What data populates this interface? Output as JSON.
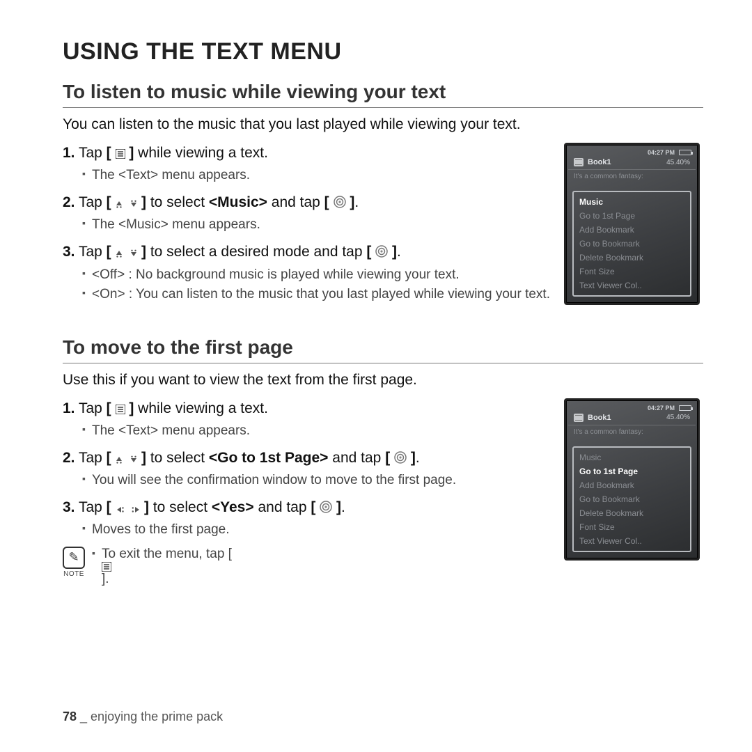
{
  "title": "USING THE TEXT MENU",
  "section1": {
    "heading": "To listen to music while viewing your text",
    "intro": "You can listen to the music that you last played while viewing your text.",
    "s1_num": "1.",
    "s1_a": " Tap ",
    "s1_b": " while viewing a text.",
    "s1_bul": "The <Text> menu appears.",
    "s2_num": "2.",
    "s2_a": " Tap ",
    "s2_b": " to select ",
    "s2_bold": "<Music>",
    "s2_c": " and tap ",
    "s2_d": ".",
    "s2_bul": "The <Music> menu appears.",
    "s3_num": "3.",
    "s3_a": " Tap ",
    "s3_b": " to select a desired mode and tap ",
    "s3_c": ".",
    "s3_bul_a": "<Off> : No background music is played while viewing your text.",
    "s3_bul_b": "<On> : You can listen to the music that you last played while viewing your text."
  },
  "section2": {
    "heading": "To move to the first page",
    "intro": "Use this if you want to view the text from the first page.",
    "s1_num": "1.",
    "s1_a": " Tap ",
    "s1_b": " while viewing a text.",
    "s1_bul": "The <Text> menu appears.",
    "s2_num": "2.",
    "s2_a": " Tap ",
    "s2_b": " to select ",
    "s2_bold": "<Go to 1st Page>",
    "s2_c": " and tap ",
    "s2_d": ".",
    "s2_bul": "You will see the confirmation window to move to the first page.",
    "s3_num": "3.",
    "s3_a": " Tap ",
    "s3_b": " to select ",
    "s3_bold": "<Yes>",
    "s3_c": " and tap ",
    "s3_d": ".",
    "s3_bul": "Moves to the first page."
  },
  "note": {
    "label": "NOTE",
    "text_a": "To exit the menu, tap ",
    "text_b": "."
  },
  "footer": {
    "page": "78",
    "sep": " _ ",
    "chapter": "enjoying the prime pack"
  },
  "device": {
    "time": "04:27 PM",
    "book": "Book1",
    "pct": "45.40%",
    "faint": "It's a common fantasy:",
    "menu": {
      "music": "Music",
      "goto1": "Go to 1st Page",
      "addbm": "Add Bookmark",
      "gotobm": "Go to Bookmark",
      "delbm": "Delete Bookmark",
      "font": "Font Size",
      "col": "Text Viewer Col.."
    }
  }
}
